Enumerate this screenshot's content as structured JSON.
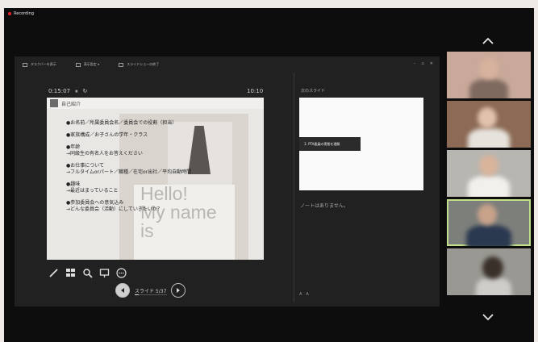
{
  "recording": {
    "label": "Recording"
  },
  "presenter_toolbar": {
    "items": [
      {
        "label": "タスクバーを表示"
      },
      {
        "label": "表示設定 ▾"
      },
      {
        "label": "スライドショーの終了"
      }
    ],
    "window_controls": [
      "–",
      "▫",
      "✕"
    ]
  },
  "presenter": {
    "elapsed_time": "0:15:07",
    "clock": "10:10",
    "next_slide_label": "次のスライド",
    "next_slide_tag": "3. PTA委員の実態を理解",
    "notes": "ノートはありません。",
    "font_controls": [
      "A",
      "A"
    ],
    "slide_counter": "スライド 5/37",
    "slide_progress": 0.135
  },
  "slide": {
    "title": "自己紹介",
    "bullets": [
      {
        "head": "●お名前／所属委員会名／委員会での役割（担当）"
      },
      {
        "head": "●家族構成／お子さんの学年・クラス"
      },
      {
        "head": "●年齢",
        "sub": "→同級生の有名人をお答えください"
      },
      {
        "head": "●お仕事について",
        "sub": "→フルタイムorパート／職種／在宅or出社／平均自動時間"
      },
      {
        "head": "●趣味",
        "sub": "→最近はまっていること"
      },
      {
        "head": "●参加委員会への意気込み",
        "sub": "→どんな委員会（活動）にしていきたいか？"
      }
    ],
    "background_text": "Hello!\nMy name\nis"
  },
  "participants": [
    {
      "bg": "#c9a99a",
      "face": "#d7b29d",
      "body": "#7f6a60"
    },
    {
      "bg": "#8c6a55",
      "face": "#e0c2ad",
      "body": "#e6e2dc"
    },
    {
      "bg": "#b8b6b1",
      "face": "#d9b49b",
      "body": "#f2f0ec"
    },
    {
      "bg": "#7d7f7b",
      "face": "#c9a28a",
      "body": "#2a3850"
    },
    {
      "bg": "#9a9893",
      "face": "#3a302a",
      "body": "#cfcdc9"
    }
  ]
}
